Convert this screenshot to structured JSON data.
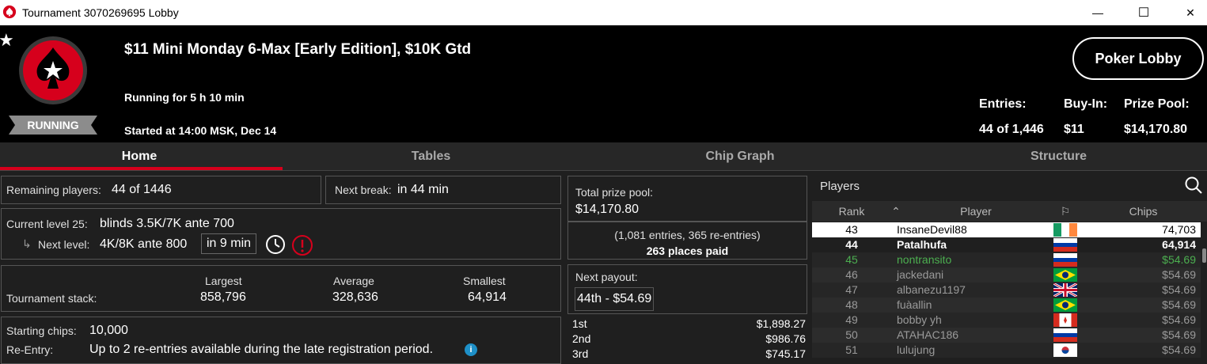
{
  "window": {
    "title": "Tournament 3070269695 Lobby",
    "minimize": "—",
    "maximize": "☐",
    "close": "✕"
  },
  "header": {
    "tournament_name": "$11 Mini Monday 6-Max [Early Edition], $10K Gtd",
    "running_for": "Running for 5 h 10 min",
    "started_at": "Started at 14:00 MSK, Dec 14",
    "status": "RUNNING",
    "lobby_button": "Poker Lobby",
    "entries_label": "Entries:",
    "entries_value": "44 of 1,446",
    "buyin_label": "Buy-In:",
    "buyin_value": "$11",
    "prizepool_label": "Prize Pool:",
    "prizepool_value": "$14,170.80"
  },
  "tabs": [
    {
      "label": "Home"
    },
    {
      "label": "Tables"
    },
    {
      "label": "Chip Graph"
    },
    {
      "label": "Structure"
    }
  ],
  "home": {
    "remaining_label": "Remaining players:",
    "remaining_value": "44 of 1446",
    "next_break_label": "Next break:",
    "next_break_value": "in 44 min",
    "current_level_label": "Current level 25:",
    "current_level_value": "blinds 3.5K/7K ante 700",
    "next_level_label": "Next level:",
    "next_level_value": "4K/8K ante 800",
    "next_level_time": "in 9 min",
    "stack_label": "Tournament stack:",
    "largest_label": "Largest",
    "largest_value": "858,796",
    "average_label": "Average",
    "average_value": "328,636",
    "smallest_label": "Smallest",
    "smallest_value": "64,914",
    "starting_chips_label": "Starting chips:",
    "starting_chips_value": "10,000",
    "reentry_label": "Re-Entry:",
    "reentry_value": "Up to 2 re-entries available during the late registration period."
  },
  "prize": {
    "total_label": "Total prize pool:",
    "total_value": "$14,170.80",
    "entries_note": "(1,081 entries, 365 re-entries)",
    "places_paid": "263 places paid",
    "next_payout_label": "Next payout:",
    "next_payout_value": "44th - $54.69",
    "payouts": [
      {
        "place": "1st",
        "amount": "$1,898.27"
      },
      {
        "place": "2nd",
        "amount": "$986.76"
      },
      {
        "place": "3rd",
        "amount": "$745.17"
      }
    ]
  },
  "players": {
    "title": "Players",
    "col_rank": "Rank",
    "col_player": "Player",
    "col_chips": "Chips",
    "rows": [
      {
        "rank": "43",
        "player": "InsaneDevil88",
        "chips": "74,703",
        "flag": "ireland-flag",
        "style": "self"
      },
      {
        "rank": "44",
        "player": "Patalhufa",
        "chips": "64,914",
        "flag": "russia-flag",
        "style": "bold"
      },
      {
        "rank": "45",
        "player": "nontransito",
        "chips": "$54.69",
        "flag": "russia-flag",
        "style": "green"
      },
      {
        "rank": "46",
        "player": "jackedani",
        "chips": "$54.69",
        "flag": "brazil-flag",
        "style": "grey"
      },
      {
        "rank": "47",
        "player": "albanezu1197",
        "chips": "$54.69",
        "flag": "uk-flag",
        "style": "grey"
      },
      {
        "rank": "48",
        "player": "fuàallin",
        "chips": "$54.69",
        "flag": "brazil-flag",
        "style": "grey"
      },
      {
        "rank": "49",
        "player": "bobby yh",
        "chips": "$54.69",
        "flag": "canada-flag",
        "style": "grey"
      },
      {
        "rank": "50",
        "player": "ATAHAC186",
        "chips": "$54.69",
        "flag": "russia-flag",
        "style": "grey"
      },
      {
        "rank": "51",
        "player": "lulujung",
        "chips": "$54.69",
        "flag": "korea-flag",
        "style": "grey"
      }
    ]
  },
  "colors": {
    "brand_red": "#d6001c",
    "self_row": "#ffffff",
    "green_text": "#4caf50"
  }
}
